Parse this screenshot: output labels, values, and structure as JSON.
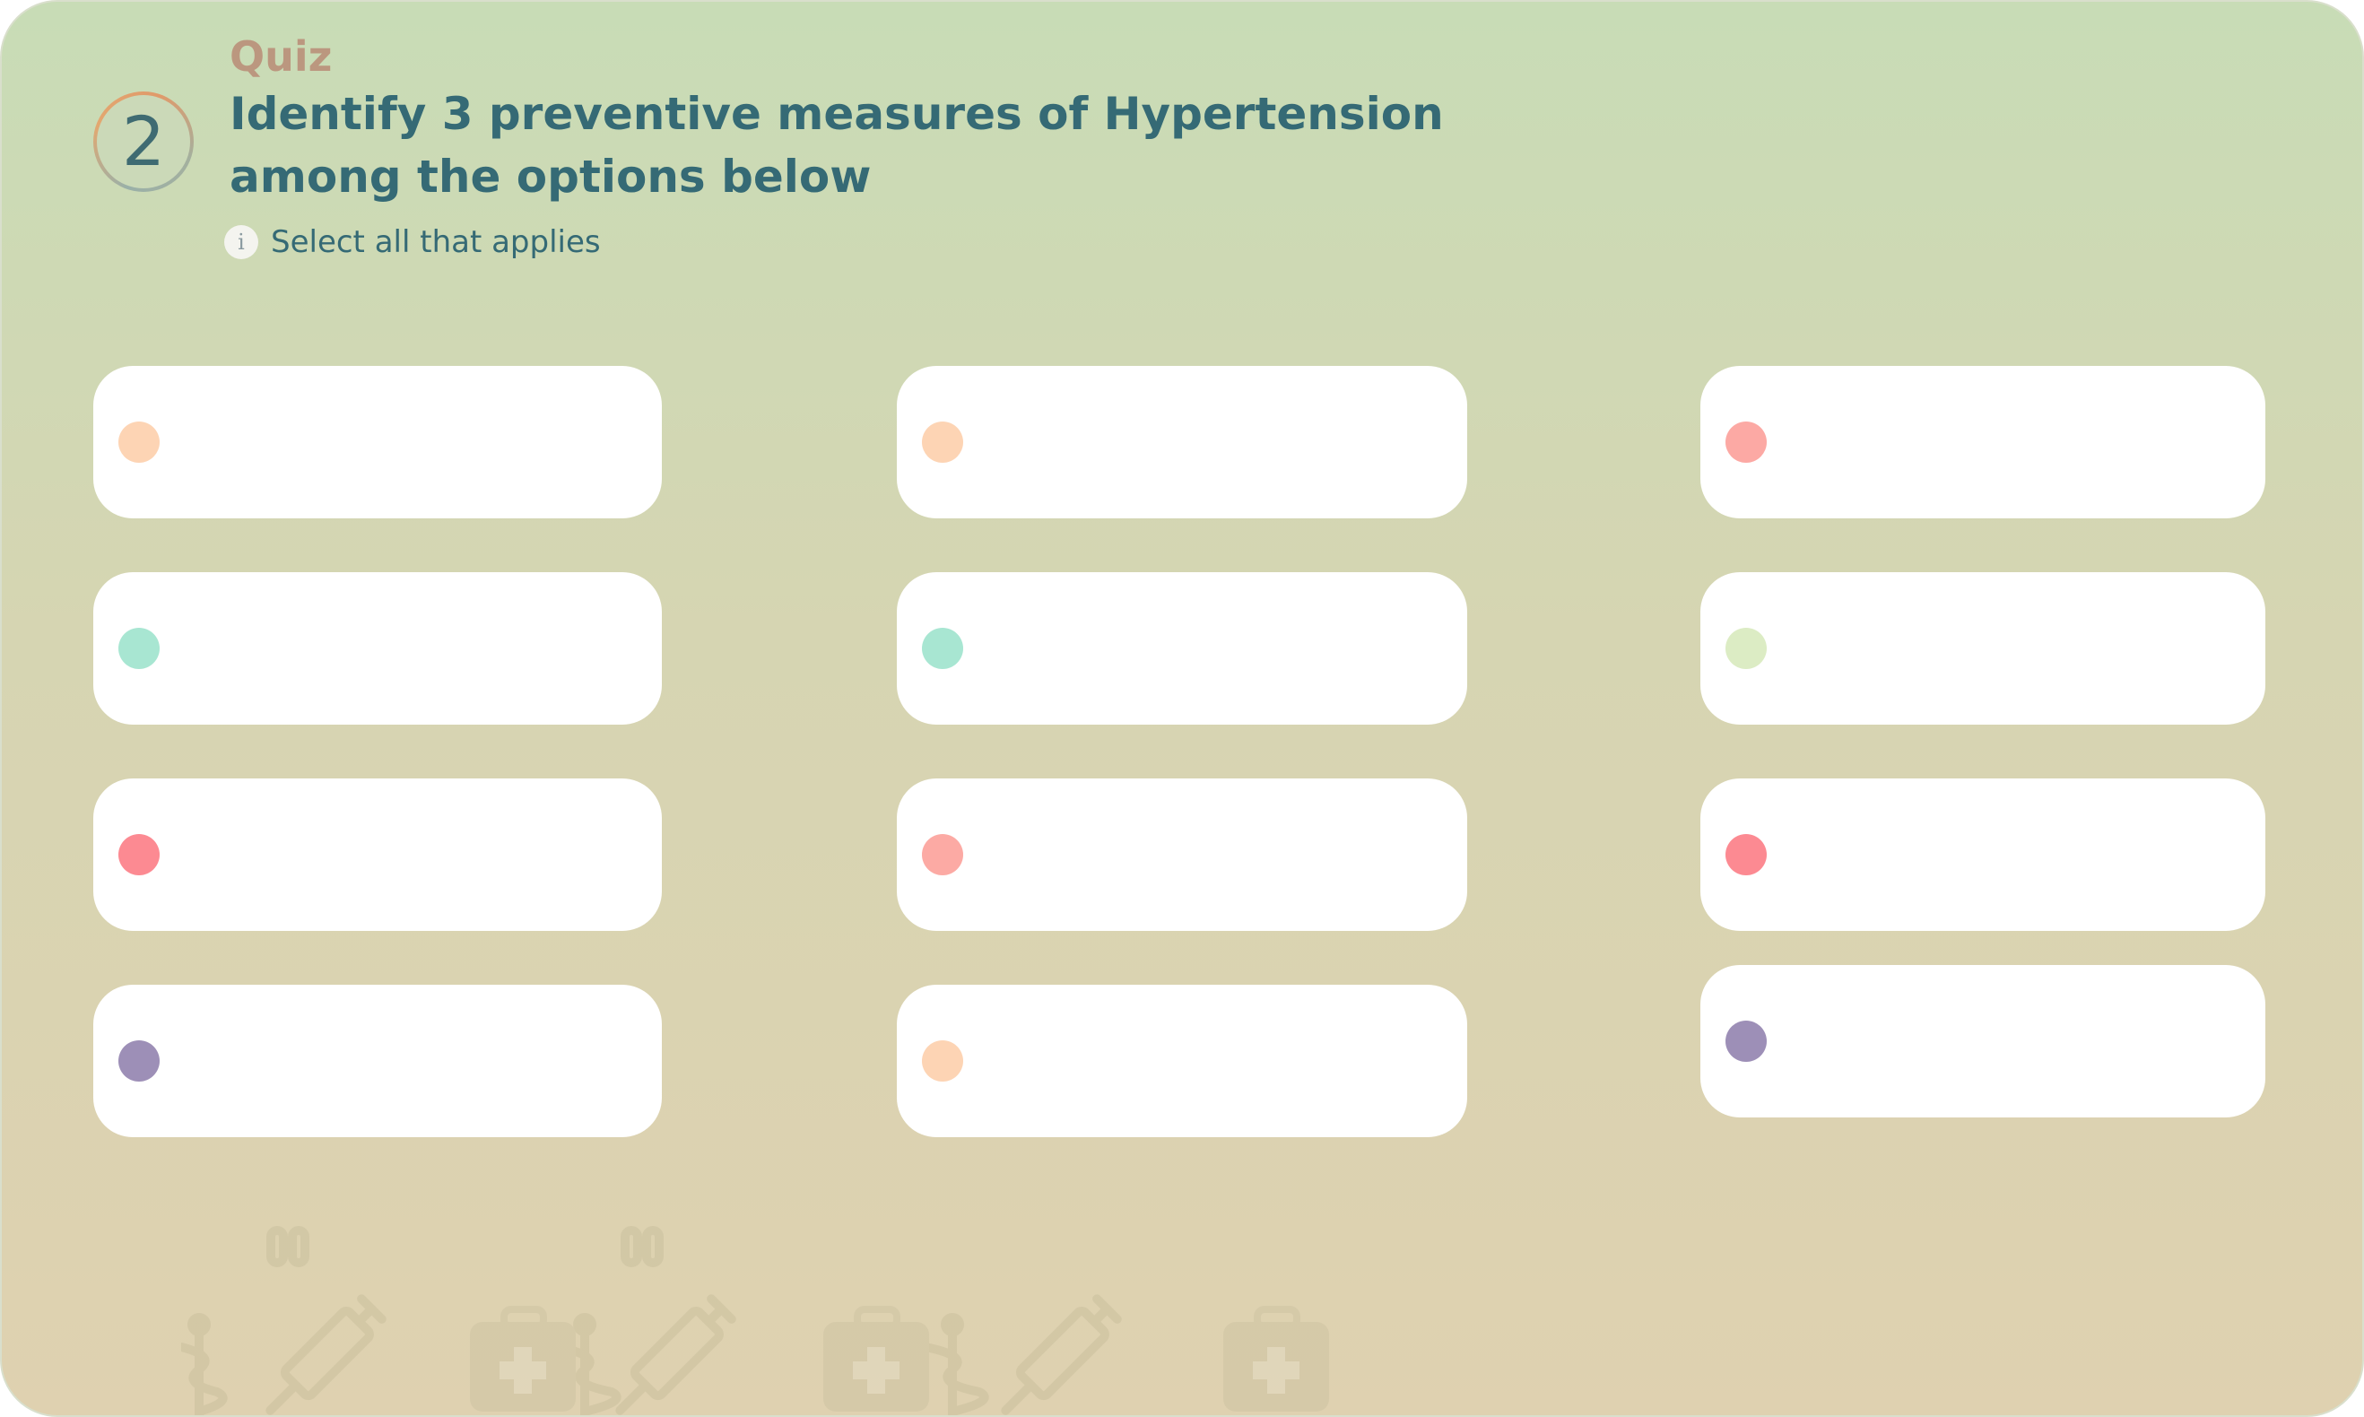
{
  "quiz": {
    "kicker": "Quiz",
    "number": "2",
    "question": "Identify 3 preventive measures of Hypertension among the options below",
    "hint_icon": "info-icon",
    "hint": "Select all that applies"
  },
  "options": [
    {
      "label": "",
      "color": "#fdd4b4"
    },
    {
      "label": "",
      "color": "#fdd4b4"
    },
    {
      "label": "",
      "color": "#fca9a4"
    },
    {
      "label": "",
      "color": "#a8e6d2"
    },
    {
      "label": "",
      "color": "#a8e6d2"
    },
    {
      "label": "",
      "color": "#dcecc4"
    },
    {
      "label": "",
      "color": "#fc8a92"
    },
    {
      "label": "",
      "color": "#fcaaa4"
    },
    {
      "label": "",
      "color": "#fc8a92"
    },
    {
      "label": "",
      "color": "#9d8fb7"
    },
    {
      "label": "",
      "color": "#fdd4b4"
    },
    {
      "label": "",
      "color": "#9d8fb7"
    }
  ],
  "decorations": [
    "caduceus-icon",
    "syringe-icon",
    "medical-kit-icon",
    "pills-icon"
  ]
}
